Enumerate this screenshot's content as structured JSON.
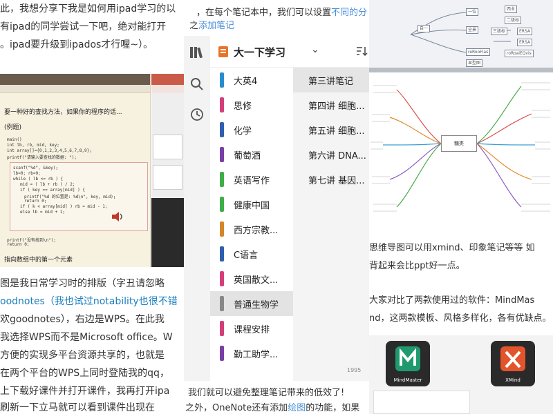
{
  "left_article": {
    "lines_top": [
      "此，我想分享下我是如何用ipad学习的以",
      "有ipad的同学尝试一下吧，绝对能打开",
      "。ipad要升级到ipados才行喔~）。"
    ],
    "lines_bottom": [
      "图是我日常学习时的排版（字丑请忽略",
      "oodnotes（我也试过notability也很不错",
      "欢goodnotes），右边是WPS。在此我",
      "我选择WPS而不是Microsoft office。W",
      "方便的实现多平台资源共享的，也就是",
      "在两个平台的WPS上同时登陆我的qq，",
      "上下载好课件并打开课件，我再打开ipa",
      "刷新一下立马就可以看到课件出现在"
    ],
    "goodnotes_shot": {
      "handwriting": [
        "要一种好的查找方法，如果你的程序的话...",
        "(例题)"
      ],
      "code_lines": [
        "main()",
        "int lb, rb, mid, key;",
        "int array[]={0,1,2,3,4,5,6,7,8,9};",
        "printf(\"请输入要查找的数据: \");",
        "scanf(\"%d\", &key);",
        "lb=0; rb=9;",
        "while ( lb <= rb ) {",
        "mid = ( lb + rb ) / 2;",
        "if ( key == array[mid] ) {",
        "printf(\"%d 的位置是: %d\\n\", key, mid);",
        "return 0;",
        "if ( k < array[mid] ) rb = mid - 1;",
        "else lb = mid + 1;",
        "printf(\"没有找到\\n\");",
        "return 0;"
      ],
      "footer": "指向数组中的第一个元素"
    }
  },
  "top_strip": {
    "line1_prefix": "，在每个笔记本中，我们可以设置",
    "line1_link": "不同的分",
    "line2_prefix": "之",
    "line2_link": "添加笔记"
  },
  "onenote": {
    "notebook_title": "大一下学习",
    "sections": [
      {
        "label": "大英4",
        "color": "#2a8ccf"
      },
      {
        "label": "思修",
        "color": "#d43f7a"
      },
      {
        "label": "化学",
        "color": "#2e5fb0"
      },
      {
        "label": "葡萄酒",
        "color": "#7a3fa6"
      },
      {
        "label": "英语写作",
        "color": "#3fae48"
      },
      {
        "label": "健康中国",
        "color": "#3fae48"
      },
      {
        "label": "西方宗教...",
        "color": "#d4862a"
      },
      {
        "label": "C语言",
        "color": "#2e5fb0"
      },
      {
        "label": "英国散文...",
        "color": "#d43f7a"
      },
      {
        "label": "普通生物学",
        "color": "#888888",
        "selected": true
      },
      {
        "label": "课程安排",
        "color": "#d43f7a"
      },
      {
        "label": "勤工助学...",
        "color": "#7a3fa6"
      }
    ],
    "pages": [
      {
        "label": "第三讲笔记",
        "selected": true
      },
      {
        "label": "第四讲 细胞..."
      },
      {
        "label": "第五讲 细胞..."
      },
      {
        "label": "第六讲 DNA..."
      },
      {
        "label": "第七讲 基因..."
      }
    ],
    "watermark": "1995"
  },
  "bottom_strip": {
    "line1": "我们就可以避免整理笔记带来的低效了!",
    "line2_prefix": "之外，OneNote还有添加",
    "line2_link": "绘图",
    "line2_suffix": "的功能，如果"
  },
  "right_panel": {
    "mindmap_top_nodes": [
      "西业",
      "一位",
      "二级标",
      "自一",
      "全景",
      "三级标",
      "ERSA",
      "ERSA",
      "reRooFlas",
      "roRoaiEQvis",
      "显型图"
    ],
    "mindmap_central": "糖类",
    "paragraph_1": [
      "思维导图可以用xmind、印象笔记等等 如",
      "背起来会比ppt好一点。"
    ],
    "paragraph_2": [
      "大家对比了两款使用过的软件：MindMas",
      "nd，这两款模板、风格多样化，各有优缺点。"
    ],
    "apps": [
      {
        "label": "MindMaster",
        "color": "#1f9a6f"
      },
      {
        "label": "XMind",
        "color": "#e2552c"
      }
    ]
  }
}
